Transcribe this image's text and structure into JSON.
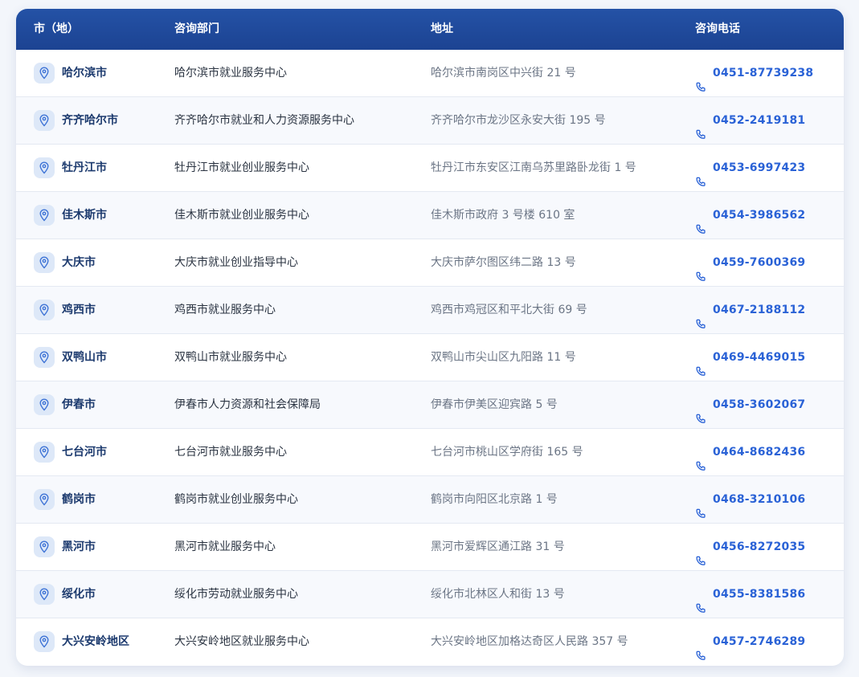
{
  "header": {
    "city": "市（地）",
    "dept": "咨询部门",
    "address": "地址",
    "phone": "咨询电话"
  },
  "colors": {
    "header_bg": "#2452a6",
    "city_text": "#1c3a6e",
    "phone_text": "#2a62d6",
    "pin_bg": "#dde8f8"
  },
  "icons": {
    "city": "map-pin-icon",
    "phone": "phone-icon"
  },
  "rows": [
    {
      "city": "哈尔滨市",
      "dept": "哈尔滨市就业服务中心",
      "address": "哈尔滨市南岗区中兴街 21 号",
      "phone": "0451-87739238"
    },
    {
      "city": "齐齐哈尔市",
      "dept": "齐齐哈尔市就业和人力资源服务中心",
      "address": "齐齐哈尔市龙沙区永安大街 195 号",
      "phone": "0452-2419181"
    },
    {
      "city": "牡丹江市",
      "dept": "牡丹江市就业创业服务中心",
      "address": "牡丹江市东安区江南乌苏里路卧龙街 1 号",
      "phone": "0453-6997423"
    },
    {
      "city": "佳木斯市",
      "dept": "佳木斯市就业创业服务中心",
      "address": "佳木斯市政府 3 号楼 610 室",
      "phone": "0454-3986562"
    },
    {
      "city": "大庆市",
      "dept": "大庆市就业创业指导中心",
      "address": "大庆市萨尔图区纬二路 13 号",
      "phone": "0459-7600369"
    },
    {
      "city": "鸡西市",
      "dept": "鸡西市就业服务中心",
      "address": "鸡西市鸡冠区和平北大街 69 号",
      "phone": "0467-2188112"
    },
    {
      "city": "双鸭山市",
      "dept": "双鸭山市就业服务中心",
      "address": "双鸭山市尖山区九阳路 11 号",
      "phone": "0469-4469015"
    },
    {
      "city": "伊春市",
      "dept": "伊春市人力资源和社会保障局",
      "address": "伊春市伊美区迎宾路 5 号",
      "phone": "0458-3602067"
    },
    {
      "city": "七台河市",
      "dept": "七台河市就业服务中心",
      "address": "七台河市桃山区学府街 165 号",
      "phone": "0464-8682436"
    },
    {
      "city": "鹤岗市",
      "dept": "鹤岗市就业创业服务中心",
      "address": "鹤岗市向阳区北京路 1 号",
      "phone": "0468-3210106"
    },
    {
      "city": "黑河市",
      "dept": "黑河市就业服务中心",
      "address": "黑河市爱辉区通江路 31 号",
      "phone": "0456-8272035"
    },
    {
      "city": "绥化市",
      "dept": "绥化市劳动就业服务中心",
      "address": "绥化市北林区人和街 13 号",
      "phone": "0455-8381586"
    },
    {
      "city": "大兴安岭地区",
      "dept": "大兴安岭地区就业服务中心",
      "address": "大兴安岭地区加格达奇区人民路 357 号",
      "phone": "0457-2746289"
    }
  ]
}
